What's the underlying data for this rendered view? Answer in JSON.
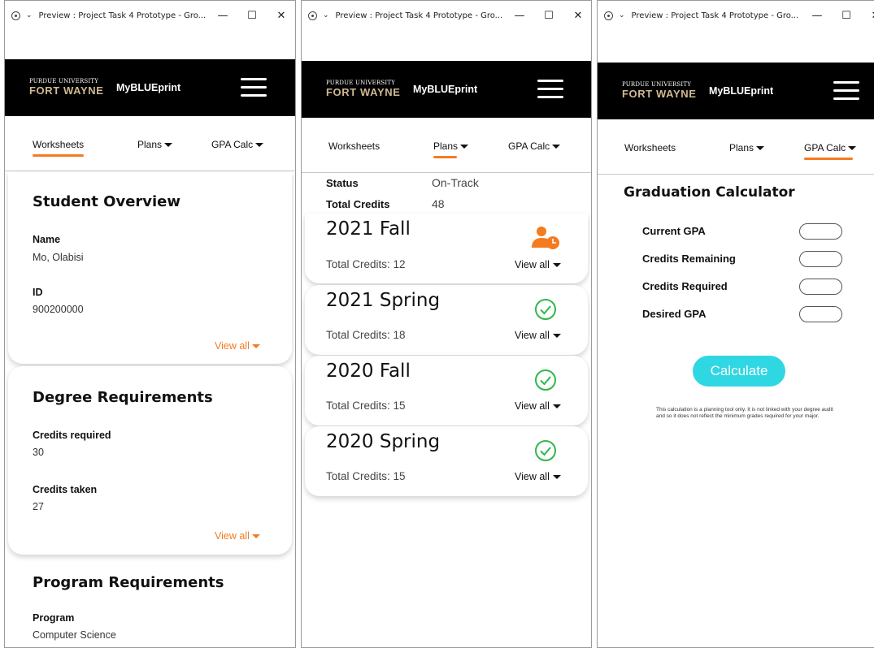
{
  "window": {
    "title": "Preview : Project Task 4 Prototype - Gro...",
    "minimize_glyph": "—",
    "maximize_glyph": "☐",
    "close_glyph": "✕"
  },
  "header": {
    "logo_line1": "PURDUE UNIVERSITY",
    "logo_line2": "FORT WAYNE",
    "brand": "MyBLUEprint"
  },
  "nav": {
    "tabs": [
      "Worksheets",
      "Plans",
      "GPA Calc"
    ]
  },
  "worksheets": {
    "student_overview": {
      "title": "Student Overview",
      "name_label": "Name",
      "name_value": "Mo, Olabisi",
      "id_label": "ID",
      "id_value": "900200000",
      "view_all": "View all"
    },
    "degree_requirements": {
      "title": "Degree Requirements",
      "credits_required_label": "Credits required",
      "credits_required_value": "30",
      "credits_taken_label": "Credits taken",
      "credits_taken_value": "27",
      "view_all": "View all"
    },
    "program_requirements": {
      "title": "Program Requirements",
      "program_label": "Program",
      "program_value": "Computer Science"
    }
  },
  "plans": {
    "status_label": "Status",
    "status_value": "On-Track",
    "total_credits_label": "Total Credits",
    "total_credits_value": "48",
    "terms": [
      {
        "name": "2021 Fall",
        "credits": "Total Credits: 12",
        "view_all": "View all",
        "icon": "user-clock-icon",
        "icon_color": "#f47b20"
      },
      {
        "name": "2021 Spring",
        "credits": "Total Credits: 18",
        "view_all": "View all",
        "icon": "check-circle-icon",
        "icon_color": "#2fb84a"
      },
      {
        "name": "2020 Fall",
        "credits": "Total Credits: 15",
        "view_all": "View all",
        "icon": "check-circle-icon",
        "icon_color": "#2fb84a"
      },
      {
        "name": "2020 Spring",
        "credits": "Total Credits: 15",
        "view_all": "View all",
        "icon": "check-circle-icon",
        "icon_color": "#2fb84a"
      }
    ]
  },
  "gpa_calc": {
    "title": "Graduation Calculator",
    "fields": [
      {
        "label": "Current GPA",
        "value": ""
      },
      {
        "label": "Credits Remaining",
        "value": ""
      },
      {
        "label": "Credits Required",
        "value": ""
      },
      {
        "label": "Desired GPA",
        "value": ""
      }
    ],
    "button": "Calculate",
    "disclaimer": "This calculation is a planning tool only. It is not linked with your degree audit and so it does not reflect the minimum grades required for your major."
  },
  "colors": {
    "accent": "#f47b20",
    "header_bg": "#000000",
    "logo_gold": "#cfb991",
    "button": "#2fd7e3",
    "success": "#2fb84a"
  }
}
